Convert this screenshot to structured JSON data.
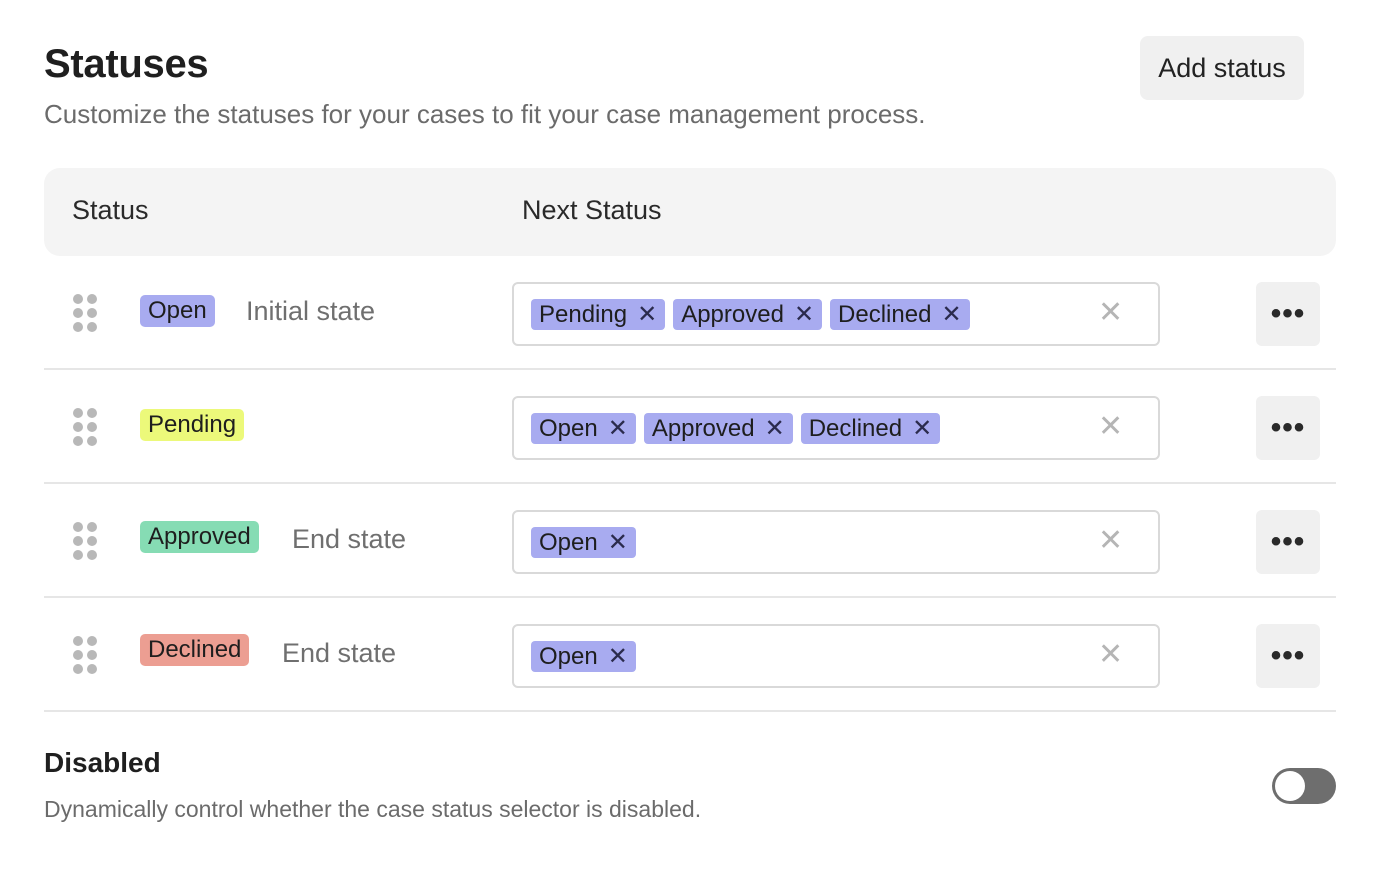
{
  "header": {
    "title": "Statuses",
    "subtitle": "Customize the statuses for your cases to fit your case management process.",
    "add_button": "Add status"
  },
  "table": {
    "columns": [
      "Status",
      "Next Status"
    ],
    "rows": [
      {
        "status": "Open",
        "badge_color": "#a8abf0",
        "state": "Initial state",
        "next": [
          "Pending",
          "Approved",
          "Declined"
        ]
      },
      {
        "status": "Pending",
        "badge_color": "#ecf97a",
        "state": "",
        "next": [
          "Open",
          "Approved",
          "Declined"
        ]
      },
      {
        "status": "Approved",
        "badge_color": "#86dcb4",
        "state": "End state",
        "next": [
          "Open"
        ]
      },
      {
        "status": "Declined",
        "badge_color": "#ec9e92",
        "state": "End state",
        "next": [
          "Open"
        ]
      }
    ],
    "chip_remove_icon": "close-icon",
    "clear_icon": "close-icon",
    "more_label": "•••"
  },
  "disabled": {
    "title": "Disabled",
    "description": "Dynamically control whether the case status selector is disabled.",
    "toggle_on": false
  }
}
